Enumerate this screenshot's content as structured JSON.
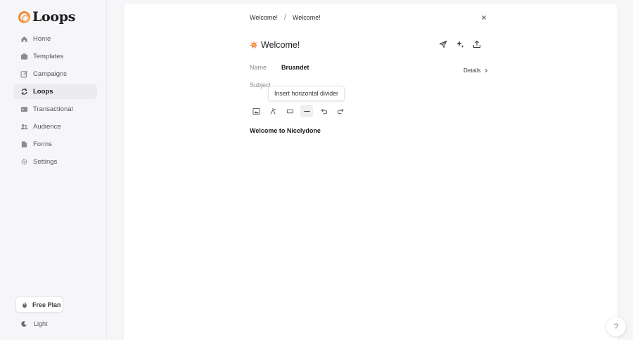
{
  "app": {
    "name": "Loops"
  },
  "sidebar": {
    "items": [
      {
        "label": "Home",
        "icon": "home-icon"
      },
      {
        "label": "Templates",
        "icon": "templates-icon"
      },
      {
        "label": "Campaigns",
        "icon": "campaigns-icon"
      },
      {
        "label": "Loops",
        "icon": "loops-icon",
        "active": true
      },
      {
        "label": "Transactional",
        "icon": "transactional-icon"
      },
      {
        "label": "Audience",
        "icon": "audience-icon"
      },
      {
        "label": "Forms",
        "icon": "forms-icon"
      },
      {
        "label": "Settings",
        "icon": "settings-icon"
      }
    ],
    "plan_label": "Free Plan",
    "theme_label": "Light"
  },
  "breadcrumb": {
    "first": "Welcome!",
    "separator": "/",
    "second": "Welcome!"
  },
  "email": {
    "title": "Welcome!",
    "name_label": "Name",
    "name_value": "Bruandet",
    "subject_label": "Subject",
    "details_label": "Details",
    "body_text": "Welcome to Nicelydone"
  },
  "tooltip": {
    "text": "Insert horizontal divider"
  },
  "toolbar": {
    "tools": [
      "image-icon",
      "component-icon",
      "button-icon",
      "divider-icon",
      "undo-icon",
      "redo-icon"
    ],
    "active_tool": "divider-icon"
  },
  "help": {
    "label": "?"
  },
  "colors": {
    "accent": "#f08a3a",
    "accent_light": "#f8b36f",
    "background": "#f6f6f8"
  }
}
